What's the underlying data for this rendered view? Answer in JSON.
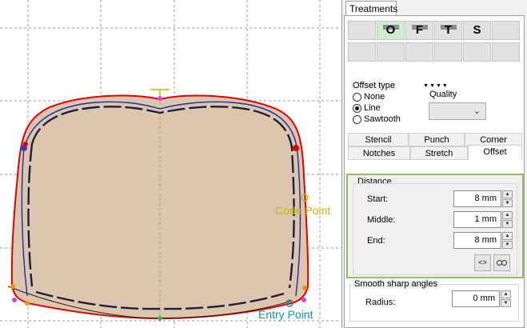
{
  "canvas": {
    "code_point_label": "Code Point",
    "entry_point_label": "Entry Point",
    "colors": {
      "fill": "#dcc6ae",
      "outline": "#e00000",
      "offset_line": "#1c2fa8",
      "code_point": "#c8b400",
      "entry_point": "#0a9a9a"
    }
  },
  "panel": {
    "tab_treatments": "Treatments",
    "treatment_buttons": [
      {
        "label": "",
        "active": false
      },
      {
        "label": "O",
        "active": true
      },
      {
        "label": "F",
        "active": false
      },
      {
        "label": "T",
        "active": false
      },
      {
        "label": "S",
        "active": false
      },
      {
        "label": "",
        "active": false
      }
    ],
    "expand_arrows": "▼▼▼▼",
    "offset_type": {
      "title": "Offset type",
      "options": [
        "None",
        "Line",
        "Sawtooth"
      ],
      "selected": "Line"
    },
    "quality": {
      "label": "Quality",
      "value": ""
    },
    "sub_tabs_row1": [
      "Stencil",
      "Punch",
      "Corner"
    ],
    "sub_tabs_row2": [
      "Notches",
      "Stretch",
      "Offset"
    ],
    "selected_sub_tab": "Offset",
    "distance": {
      "title": "Distance",
      "start_label": "Start:",
      "start_value": "8 mm",
      "middle_label": "Middle:",
      "middle_value": "1 mm",
      "end_label": "End:",
      "end_value": "8 mm"
    },
    "smooth": {
      "title": "Smooth sharp angles",
      "radius_label": "Radius:",
      "radius_value": "0 mm"
    }
  }
}
